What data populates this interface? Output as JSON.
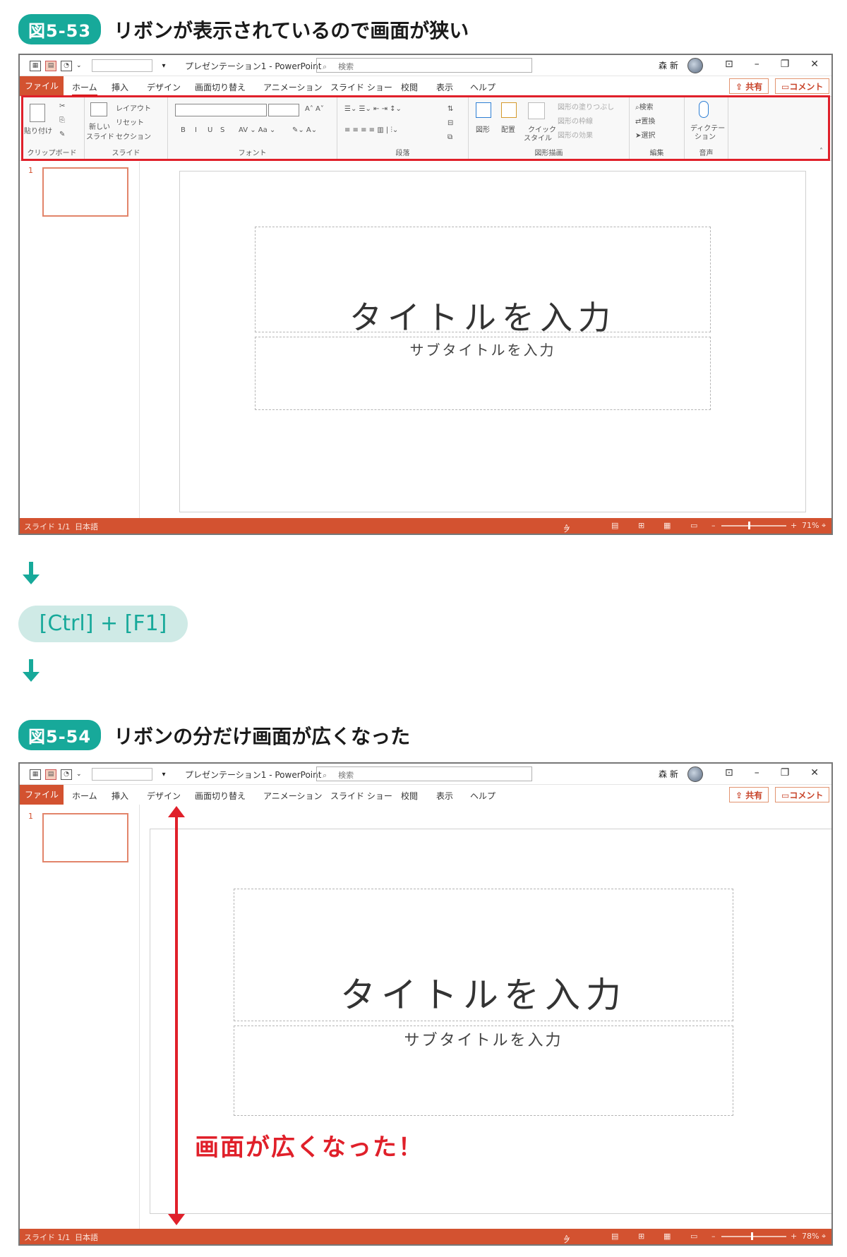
{
  "fig1": {
    "badge": "図5-53",
    "title": "リボンが表示されているので画面が狭い",
    "doc_title": "プレゼンテーション1  -  PowerPoint",
    "search_label": "検索",
    "user": "森 新",
    "tabs": [
      "ファイル",
      "ホーム",
      "挿入",
      "デザイン",
      "画面切り替え",
      "アニメーション",
      "スライド ショー",
      "校閲",
      "表示",
      "ヘルプ"
    ],
    "share": "共有",
    "comment": "コメント",
    "ribbon": {
      "clipboard": {
        "label": "クリップボード",
        "paste": "貼り付け"
      },
      "slides": {
        "label": "スライド",
        "new": "新しい",
        "new2": "スライド",
        "layout": "レイアウト",
        "reset": "リセット",
        "section": "セクション"
      },
      "font": {
        "label": "フォント",
        "b": "B",
        "i": "I",
        "u": "U",
        "s": "S"
      },
      "paragraph": {
        "label": "段落"
      },
      "drawing": {
        "label": "図形描画",
        "shape": "図形",
        "arrange": "配置",
        "quick": "クイック",
        "quick2": "スタイル",
        "fill": "図形の塗りつぶし",
        "outline": "図形の枠線",
        "effect": "図形の効果"
      },
      "editing": {
        "label": "編集",
        "find": "検索",
        "replace": "置換",
        "select": "選択"
      },
      "voice": {
        "label": "音声",
        "dictate": "ディクテー",
        "dictate2": "ション"
      }
    },
    "thumb_num": "1",
    "slide_title": "タイトルを入力",
    "slide_subtitle": "サブタイトルを入力",
    "status_slide": "スライド 1/1",
    "status_lang": "日本語",
    "status_notes": "ノート",
    "zoom": "71%"
  },
  "keys": "[Ctrl] + [F1]",
  "fig2": {
    "badge": "図5-54",
    "title": "リボンの分だけ画面が広くなった",
    "doc_title": "プレゼンテーション1  -  PowerPoint",
    "search_label": "検索",
    "user": "森 新",
    "tabs": [
      "ファイル",
      "ホーム",
      "挿入",
      "デザイン",
      "画面切り替え",
      "アニメーション",
      "スライド ショー",
      "校閲",
      "表示",
      "ヘルプ"
    ],
    "share": "共有",
    "comment": "コメント",
    "thumb_num": "1",
    "slide_title": "タイトルを入力",
    "slide_subtitle": "サブタイトルを入力",
    "status_slide": "スライド 1/1",
    "status_lang": "日本語",
    "status_notes": "ノート",
    "zoom": "78%",
    "note": "画面が広くなった！"
  },
  "colors": {
    "accent": "#17a99a",
    "office": "#d35230",
    "highlight": "#e0202a"
  }
}
